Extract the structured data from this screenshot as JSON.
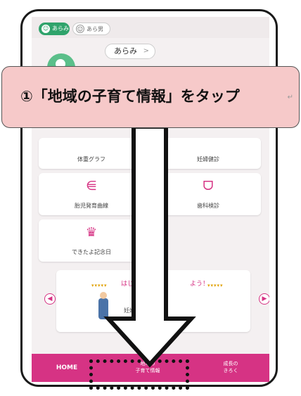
{
  "tabs": [
    {
      "label": "あらみ",
      "icon": "baby-face-icon",
      "active": true
    },
    {
      "label": "あら男",
      "icon": "baby-face-icon",
      "active": false
    }
  ],
  "profile": {
    "name": "あらみ",
    "chevron": ">"
  },
  "menu": [
    {
      "label": "体重グラフ",
      "icon": "scale-icon"
    },
    {
      "label": "妊婦健診",
      "icon": "stethoscope-icon"
    },
    {
      "label": "胎児発育曲線",
      "icon": "growth-curve-icon",
      "glyph": "⋹"
    },
    {
      "label": "歯科検診",
      "icon": "tooth-icon",
      "glyph": "ᗜ"
    },
    {
      "label": "できたよ記念日",
      "icon": "crown-icon",
      "glyph": "♛"
    }
  ],
  "banner": {
    "title": "はじめ",
    "title_tail": "よう！",
    "body": "妊娠〇日",
    "prev": "◀",
    "next": "▶"
  },
  "bottom_nav": {
    "home": "HOME",
    "local_line1": "地域の",
    "local_line2": "子育て情報",
    "growth_line1": "成長の",
    "growth_line2": "きろく"
  },
  "callout": {
    "text": "①「地域の子育て情報」をタップ",
    "mark": "↵"
  },
  "colors": {
    "accent": "#d63384",
    "green": "#2fa36b",
    "callout": "#f6c9c9"
  }
}
